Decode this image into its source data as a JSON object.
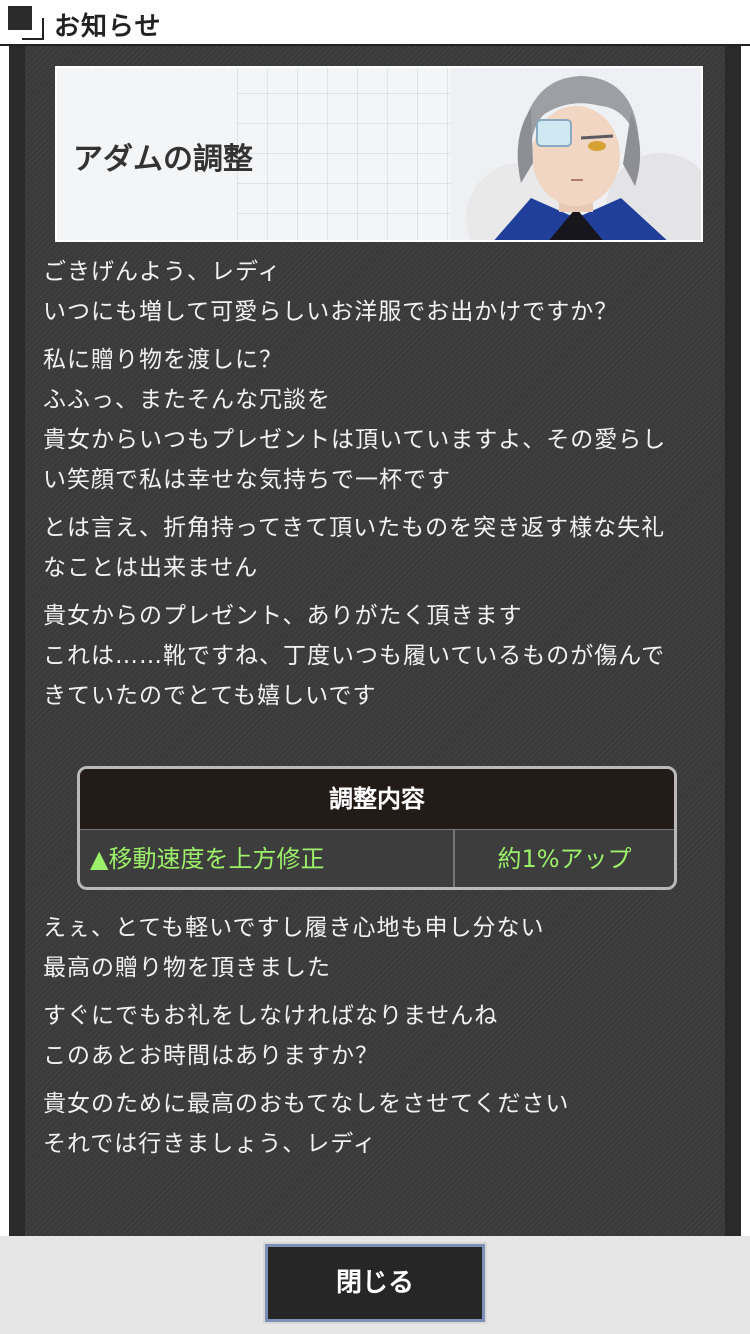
{
  "header": {
    "title": "お知らせ"
  },
  "banner": {
    "title": "アダムの調整",
    "image_description": "character-portrait"
  },
  "paragraphs_before": [
    [
      "ごきげんよう、レディ",
      "いつにも増して可愛らしいお洋服でお出かけですか？"
    ],
    [
      "私に贈り物を渡しに？",
      "ふふっ、またそんな冗談を",
      "貴女からいつもプレゼントは頂いていますよ、その愛らし",
      "い笑顔で私は幸せな気持ちで一杯です"
    ],
    [
      "とは言え、折角持ってきて頂いたものを突き返す様な失礼",
      "なことは出来ません"
    ],
    [
      "貴女からのプレゼント、ありがたく頂きます",
      "これは……靴ですね、丁度いつも履いているものが傷んで",
      "きていたのでとても嬉しいです"
    ]
  ],
  "adjustment_table": {
    "header": "調整内容",
    "item": "▲移動速度を上方修正",
    "value": "約1%アップ",
    "value_color": "#9df06a"
  },
  "paragraphs_after": [
    [
      "えぇ、とても軽いですし履き心地も申し分ない",
      "最高の贈り物を頂きました"
    ],
    [
      "すぐにでもお礼をしなければなりませんね",
      "このあとお時間はありますか？"
    ],
    [
      "貴女のために最高のおもてなしをさせてください",
      "それでは行きましょう、レディ"
    ]
  ],
  "footer": {
    "close_label": "閉じる"
  }
}
